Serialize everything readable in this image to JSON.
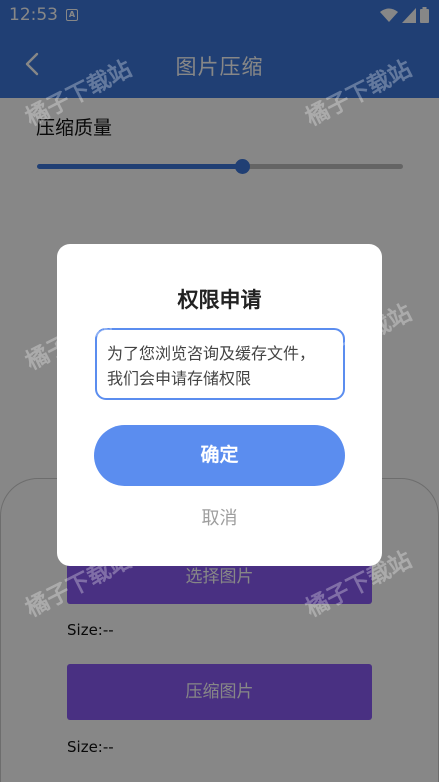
{
  "status_bar": {
    "time": "12:53",
    "notification_badge": "A",
    "icons": [
      "wifi-icon",
      "signal-icon",
      "battery-icon"
    ]
  },
  "app_bar": {
    "title": "图片压缩",
    "back_icon": "chevron-left-icon"
  },
  "content": {
    "quality_label": "压缩质量",
    "quality_level_fraction": 0.56,
    "select_button": "选择图片",
    "size_1": "Size:--",
    "compress_button": "压缩图片",
    "size_2": "Size:--"
  },
  "dialog": {
    "title": "权限申请",
    "message": "为了您浏览咨询及缓存文件，\n我们会申请存储权限",
    "confirm": "确定",
    "cancel": "取消"
  },
  "watermark": "橘子下载站",
  "colors": {
    "primary": "#3d78db",
    "dialog_accent": "#5b8def",
    "action_button": "#8a5cf5"
  }
}
